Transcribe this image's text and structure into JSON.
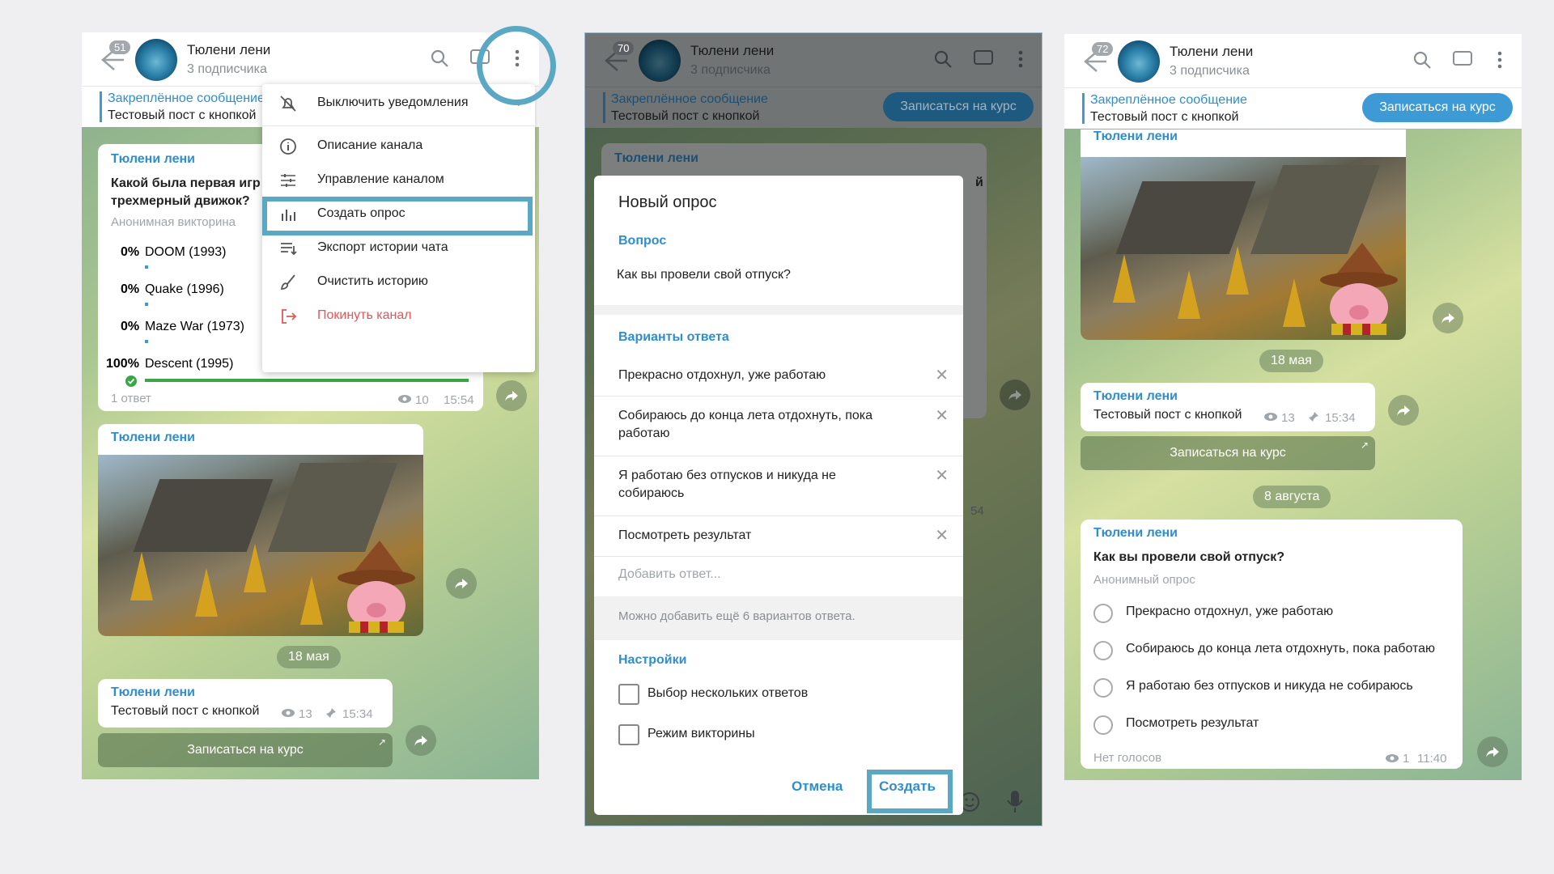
{
  "colors": {
    "accent": "#2f8ecb",
    "callout": "#5aa8c4",
    "danger": "#e25858",
    "vote_bar": "#3aa647"
  },
  "channel": {
    "title": "Тюлени лени",
    "subtitle": "3 подписчика"
  },
  "pinned": {
    "title": "Закреплённое сообщение",
    "text": "Тестовый пост с кнопкой",
    "button": "Записаться на курс"
  },
  "panel1": {
    "unread": "51",
    "quiz": {
      "author": "Тюлени лени",
      "question_line1": "Какой была первая игр",
      "question_line2": "трехмерный движок?",
      "type": "Анонимная викторина",
      "options": [
        {
          "pct": "0%",
          "label": "DOOM (1993)"
        },
        {
          "pct": "0%",
          "label": "Quake (1996)"
        },
        {
          "pct": "0%",
          "label": "Maze War (1973)"
        },
        {
          "pct": "100%",
          "label": "Descent (1995)"
        }
      ],
      "footer": "1 ответ",
      "views": "10",
      "time": "15:54"
    },
    "photo_author": "Тюлени лени",
    "date": "18 мая",
    "post": {
      "author": "Тюлени лени",
      "text": "Тестовый пост с кнопкой",
      "views": "13",
      "time": "15:34",
      "button": "Записаться на курс"
    },
    "menu": [
      "Выключить уведомления",
      "Описание канала",
      "Управление каналом",
      "Создать опрос",
      "Экспорт истории чата",
      "Очистить историю",
      "Покинуть канал"
    ]
  },
  "panel2": {
    "unread": "70",
    "bg_author": "Тюлени лени",
    "bg_fragment": "й",
    "bg_time": "54",
    "modal": {
      "title": "Новый опрос",
      "question_label": "Вопрос",
      "question": "Как вы провели свой отпуск?",
      "answers_label": "Варианты ответа",
      "answers": [
        "Прекрасно отдохнул, уже работаю",
        "Собираюсь до конца лета отдохнуть, пока работаю",
        "Я работаю без отпусков и никуда не собираюсь",
        "Посмотреть результат"
      ],
      "add_placeholder": "Добавить ответ...",
      "hint": "Можно добавить ещё 6 вариантов ответа.",
      "settings_label": "Настройки",
      "multi": "Выбор нескольких ответов",
      "quiz_mode": "Режим викторины",
      "cancel": "Отмена",
      "create": "Создать"
    }
  },
  "panel3": {
    "unread": "72",
    "photo_author": "Тюлени лени",
    "date1": "18 мая",
    "post": {
      "author": "Тюлени лени",
      "text": "Тестовый пост с кнопкой",
      "views": "13",
      "time": "15:34",
      "button": "Записаться на курс"
    },
    "date2": "8 августа",
    "poll": {
      "author": "Тюлени лени",
      "question": "Как вы провели свой отпуск?",
      "type": "Анонимный опрос",
      "options": [
        "Прекрасно отдохнул, уже работаю",
        "Собираюсь до конца лета отдохнуть, пока работаю",
        "Я работаю без отпусков и никуда не собираюсь",
        "Посмотреть результат"
      ],
      "footer": "Нет голосов",
      "views": "1",
      "time": "11:40"
    }
  }
}
